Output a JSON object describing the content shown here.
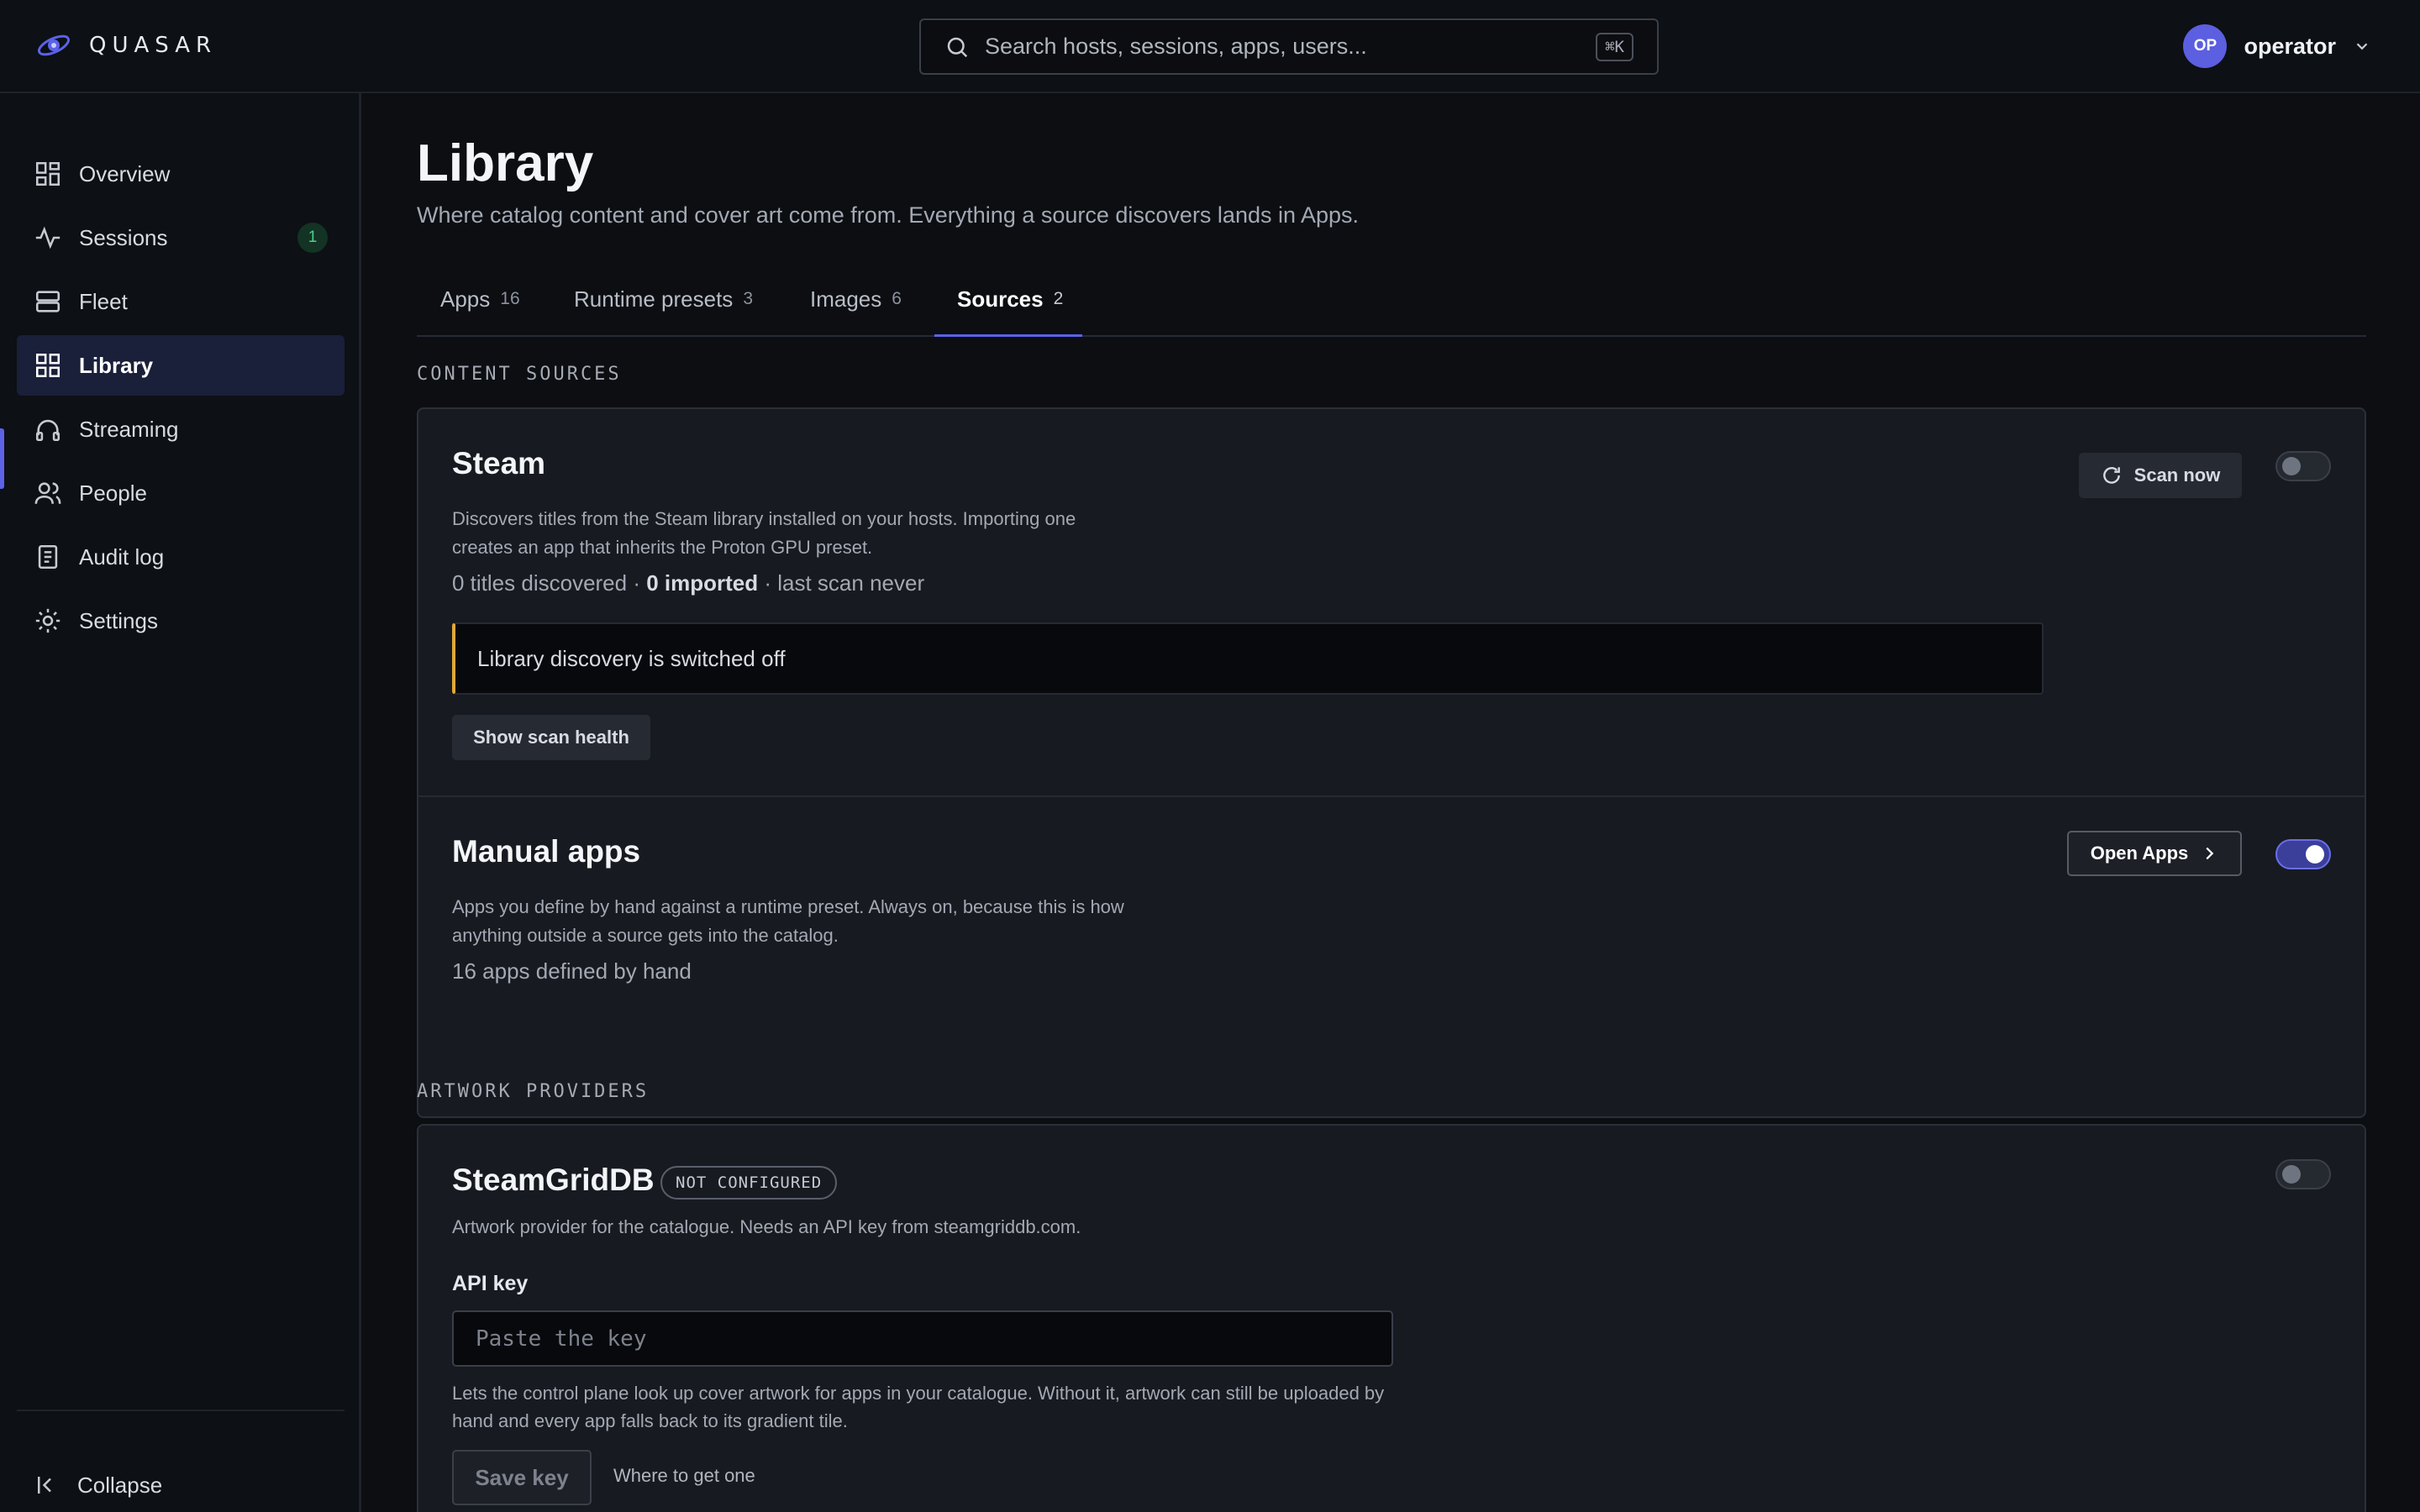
{
  "brand": {
    "name": "QUASAR"
  },
  "search": {
    "placeholder": "Search hosts, sessions, apps, users...",
    "shortcut": "⌘K"
  },
  "user": {
    "initials": "OP",
    "name": "operator"
  },
  "sidebar": {
    "items": [
      {
        "label": "Overview",
        "icon": "grid-icon"
      },
      {
        "label": "Sessions",
        "icon": "activity-icon",
        "badge": "1"
      },
      {
        "label": "Fleet",
        "icon": "server-icon"
      },
      {
        "label": "Library",
        "icon": "apps-grid-icon",
        "active": true
      },
      {
        "label": "Streaming",
        "icon": "headphones-icon"
      },
      {
        "label": "People",
        "icon": "users-icon"
      },
      {
        "label": "Audit log",
        "icon": "document-icon"
      },
      {
        "label": "Settings",
        "icon": "gear-icon"
      }
    ],
    "collapse_label": "Collapse"
  },
  "page": {
    "title": "Library",
    "subtitle": "Where catalog content and cover art come from. Everything a source discovers lands in Apps."
  },
  "tabs": [
    {
      "label": "Apps",
      "count": "16"
    },
    {
      "label": "Runtime presets",
      "count": "3"
    },
    {
      "label": "Images",
      "count": "6"
    },
    {
      "label": "Sources",
      "count": "2",
      "active": true
    }
  ],
  "content_sources": {
    "heading": "CONTENT SOURCES",
    "steam": {
      "title": "Steam",
      "description": "Discovers titles from the Steam library installed on your hosts. Importing one creates an app that inherits the Proton GPU preset.",
      "stats_prefix": "0 titles discovered · ",
      "stats_bold": "0 imported",
      "stats_suffix": " · last scan never",
      "scan_label": "Scan now",
      "enabled": false,
      "notice": "Library discovery is switched off",
      "health_label": "Show scan health"
    },
    "manual": {
      "title": "Manual apps",
      "description": "Apps you define by hand against a runtime preset. Always on, because this is how anything outside a source gets into the catalog.",
      "stats": "16 apps defined by hand",
      "open_label": "Open Apps",
      "enabled": true
    }
  },
  "artwork_providers": {
    "heading": "ARTWORK PROVIDERS",
    "steamgriddb": {
      "title": "SteamGridDB",
      "status_badge": "NOT CONFIGURED",
      "description": "Artwork provider for the catalogue. Needs an API key from steamgriddb.com.",
      "enabled": false,
      "api_key_label": "API key",
      "api_key_placeholder": "Paste the key",
      "api_key_value": "",
      "help": "Lets the control plane look up cover artwork for apps in your catalogue. Without it, artwork can still be uploaded by hand and every app falls back to its gradient tile.",
      "save_label": "Save key",
      "where_link": "Where to get one"
    }
  },
  "colors": {
    "accent": "#5b62e8",
    "warning": "#e0a83a",
    "success": "#4fd08a"
  }
}
